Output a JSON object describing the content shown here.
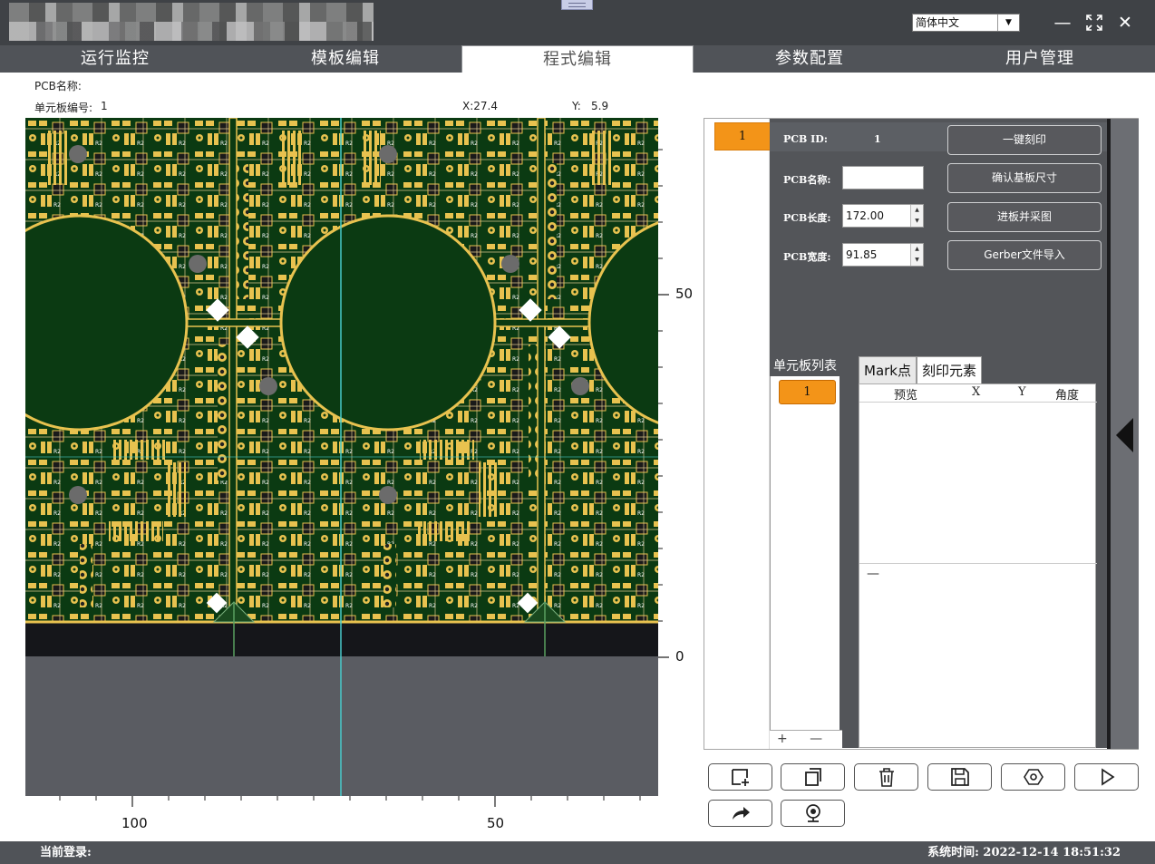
{
  "window": {
    "language_select": "简体中文",
    "minimize_icon": "minimize-icon",
    "fullscreen_icon": "fullscreen-icon",
    "close_icon": "close-icon"
  },
  "tabs": [
    {
      "label": "运行监控",
      "active": false
    },
    {
      "label": "模板编辑",
      "active": false
    },
    {
      "label": "程式编辑",
      "active": true
    },
    {
      "label": "参数配置",
      "active": false
    },
    {
      "label": "用户管理",
      "active": false
    }
  ],
  "info": {
    "pcb_name_label": "PCB名称:",
    "unit_board_no_label": "单元板编号:",
    "unit_board_no_value": "1",
    "x_readout": "X:27.4",
    "y_label": "Y:",
    "y_value": "5.9"
  },
  "rulers": {
    "right_labels": [
      "50",
      "0"
    ],
    "bottom_labels": [
      "100",
      "50"
    ]
  },
  "board_list": {
    "top_item": "1"
  },
  "params": {
    "pcb_id_label": "PCB ID:",
    "pcb_id_value": "1",
    "pcb_name_label": "PCB名称:",
    "pcb_name_value": "",
    "pcb_length_label": "PCB长度:",
    "pcb_length_value": "172.00",
    "pcb_width_label": "PCB宽度:",
    "pcb_width_value": "91.85"
  },
  "actions": {
    "one_key_engrave": "一键刻印",
    "confirm_board_size": "确认基板尺寸",
    "feed_and_capture": "进板并采图",
    "gerber_import": "Gerber文件导入"
  },
  "unit_list": {
    "title": "单元板列表",
    "items": [
      "1"
    ],
    "footer": "+ —"
  },
  "element_tabs": [
    {
      "label": "Mark点",
      "active": false
    },
    {
      "label": "刻印元素",
      "active": true
    }
  ],
  "element_table": {
    "columns": [
      "预览",
      "X",
      "Y",
      "角度"
    ],
    "rows": [],
    "footer_dash": "—"
  },
  "toolbar_icons": [
    "add-frame-icon",
    "copy-icon",
    "delete-icon",
    "save-icon",
    "hexagon-icon",
    "play-icon",
    "redo-arrow-icon",
    "camera-icon"
  ],
  "status": {
    "login_label": "当前登录:",
    "system_time": "系统时间: 2022-12-14 18:51:32"
  },
  "colors": {
    "accent_orange": "#f39418",
    "dark_panel": "#535559",
    "pcb_green": "#0b3a12",
    "pad_gold": "#e8c24f",
    "crosshair": "#48c9c9"
  }
}
